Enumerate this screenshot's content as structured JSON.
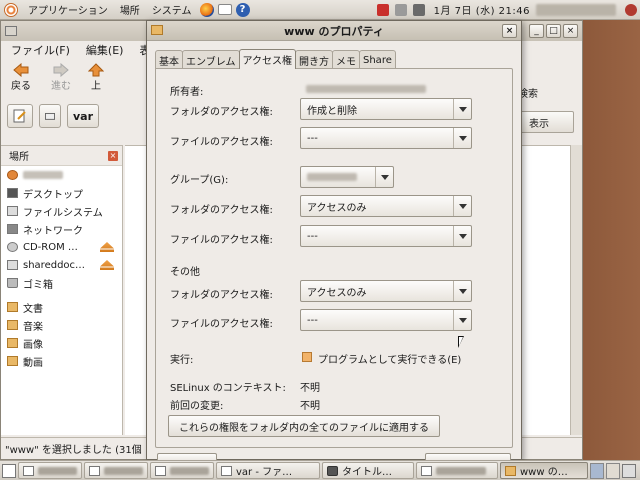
{
  "top_panel": {
    "menus": [
      "アプリケーション",
      "場所",
      "システム"
    ],
    "clock": "1月 7日 (水) 21:46"
  },
  "file_manager": {
    "menubar": [
      "ファイル(F)",
      "編集(E)",
      "表"
    ],
    "toolbar": {
      "back": "戻る",
      "forward": "進む",
      "up": "上"
    },
    "search_label": "検索",
    "location": "var",
    "view_combo": "表示",
    "sidebar": {
      "header": "場所",
      "items": [
        "デスクトップ",
        "ファイルシステム",
        "ネットワーク",
        "CD-ROM …",
        "shareddoc…",
        "ゴミ箱"
      ],
      "bookmarks": [
        "文書",
        "音楽",
        "画像",
        "動画"
      ]
    },
    "status": "\"www\" を選択しました (31個"
  },
  "dialog": {
    "title": "www のプロパティ",
    "tabs": [
      "基本",
      "エンブレム",
      "アクセス権",
      "開き方",
      "メモ",
      "Share"
    ],
    "active_tab": "アクセス権",
    "owner_section": "所有者:",
    "group_section": "グループ(G):",
    "other_section": "その他",
    "folder_access_label": "フォルダのアクセス権:",
    "file_access_label": "ファイルのアクセス権:",
    "owner": {
      "folder_access": "作成と削除",
      "file_access": "---"
    },
    "group": {
      "folder_access": "アクセスのみ",
      "file_access": "---"
    },
    "other": {
      "folder_access": "アクセスのみ",
      "file_access": "---"
    },
    "execute_label": "実行:",
    "execute_checkbox": "プログラムとして実行できる(E)",
    "selinux_label": "SELinux のコンテキスト:",
    "selinux_value": "不明",
    "last_changed_label": "前回の変更:",
    "last_changed_value": "不明",
    "apply_button": "これらの権限をフォルダ内の全てのファイルに適用する"
  },
  "taskbar": {
    "items": [
      "var - ファ…",
      "タイトル…",
      "www の…"
    ]
  }
}
